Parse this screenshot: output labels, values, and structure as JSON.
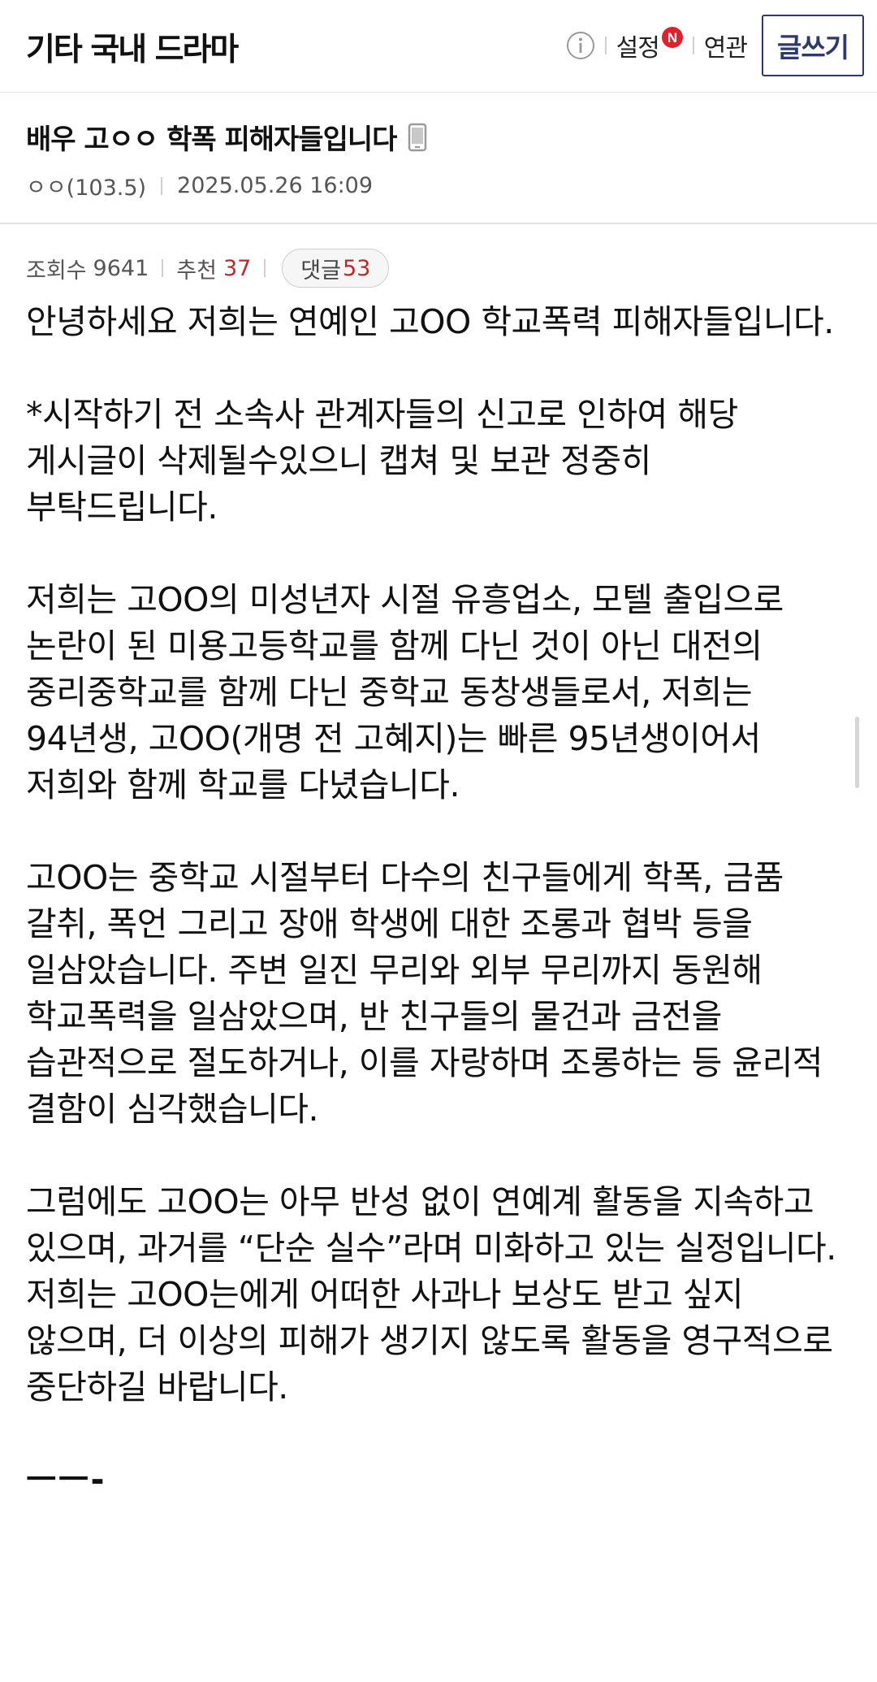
{
  "header": {
    "board_name": "기타 국내 드라마",
    "settings_label": "설정",
    "new_badge": "N",
    "related_label": "연관",
    "write_label": "글쓰기"
  },
  "post": {
    "title": "배우 고ㅇㅇ 학폭 피해자들입니다",
    "author": "ㅇㅇ(103.5)",
    "datetime": "2025.05.26 16:09",
    "views_label": "조회수",
    "views": "9641",
    "recommend_label": "추천",
    "recommend": "37",
    "comments_label": "댓글",
    "comments": "53"
  },
  "body": {
    "paragraphs": [
      "안녕하세요 저희는 연예인 고OO 학교폭력 피해자들입니다.",
      "*시작하기 전 소속사 관계자들의 신고로 인하여 해당 게시글이 삭제될수있으니 캡쳐 및 보관 정중히 부탁드립니다.",
      "저희는 고OO의 미성년자 시절 유흥업소, 모텔 출입으로 논란이 된 미용고등학교를 함께 다닌 것이 아닌 대전의 중리중학교를 함께 다닌 중학교 동창생들로서, 저희는 94년생, 고OO(개명 전 고혜지)는 빠른 95년생이어서 저희와 함께 학교를 다녔습니다.",
      "고OO는 중학교 시절부터 다수의 친구들에게 학폭, 금품 갈취, 폭언 그리고 장애 학생에 대한 조롱과 협박 등을 일삼았습니다. 주변 일진 무리와 외부 무리까지 동원해 학교폭력을 일삼았으며, 반 친구들의 물건과 금전을 습관적으로 절도하거나, 이를 자랑하며 조롱하는 등 윤리적 결함이 심각했습니다.",
      "그럼에도 고OO는 아무 반성 없이 연예계 활동을 지속하고 있으며, 과거를 “단순 실수”라며 미화하고 있는 실정입니다. 저희는 고OO는에게 어떠한 사과나 보상도 받고 싶지 않으며, 더 이상의 피해가 생기지 않도록 활동을 영구적으로 중단하길 바랍니다."
    ],
    "divider": "ㅡㅡ-"
  },
  "icons": {
    "info": "info-circle-icon",
    "phone": "mobile-phone-icon",
    "new": "new-badge-icon"
  },
  "colors": {
    "accent_navy": "#2d3a6b",
    "recommend_red": "#c0272d",
    "new_badge_red": "#e0202a"
  }
}
